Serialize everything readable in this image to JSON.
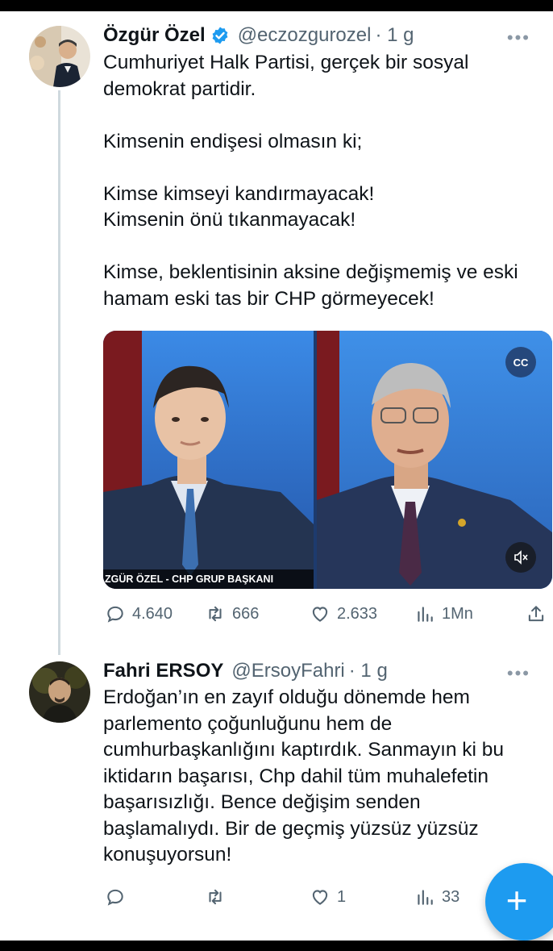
{
  "tweet1": {
    "name": "Özgür Özel",
    "handle": "@eczozgurozel",
    "time": "· 1 g",
    "text": "Cumhuriyet Halk Partisi, gerçek bir sosyal\ndemokrat partidir.\n\nKimsenin endişesi olmasın ki;\n\nKimse kimseyi kandırmayacak!\nKimsenin önü tıkanmayacak!\n\nKimse, beklentisinin aksine değişmemiş ve eski\nhamam eski tas bir CHP görmeyecek!",
    "media_caption": "ZGÜR ÖZEL - CHP GRUP BAŞKANI",
    "replies": "4.640",
    "reposts": "666",
    "likes": "2.633",
    "views": "1Mn"
  },
  "tweet2": {
    "name": "Fahri ERSOY",
    "handle": "@ErsoyFahri",
    "time": "· 1 g",
    "text": "Erdoğan’ın en zayıf olduğu dönemde hem\nparlemento çoğunluğunu hem de\ncumhurbaşkanlığını kaptırdık. Sanmayın ki bu\niktidarın başarısı, Chp dahil tüm muhalefetin\nbaşarısızlığı. Bence değişim senden\nbaşlamalıydı. Bir de geçmiş yüzsüz yüzsüz\nkonuşuyorsun!",
    "replies": "",
    "reposts": "",
    "likes": "1",
    "views": "33"
  },
  "more_glyph": "•••",
  "compose_glyph": "+",
  "colors": {
    "accent": "#1d9bf0",
    "secondary_text": "#536471",
    "primary_text": "#0f1419"
  },
  "icons": [
    "verified-badge-icon",
    "more-icon",
    "reply-icon",
    "repost-icon",
    "like-icon",
    "views-icon",
    "share-icon",
    "captions-icon",
    "mute-icon",
    "compose-icon"
  ]
}
